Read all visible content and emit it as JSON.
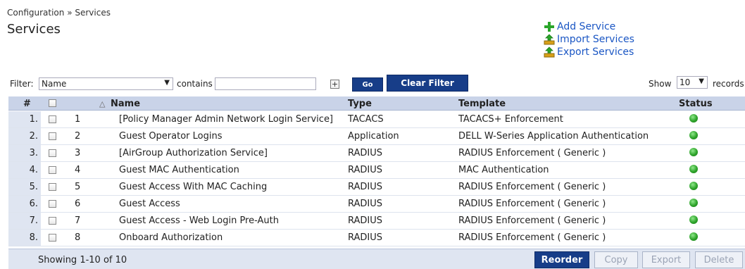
{
  "breadcrumb": "Configuration » Services",
  "page_title": "Services",
  "actions": {
    "add": "Add Service",
    "import": "Import Services",
    "export": "Export Services"
  },
  "filter": {
    "label": "Filter:",
    "field": "Name",
    "operator": "contains",
    "value": "",
    "go": "Go",
    "clear": "Clear Filter",
    "show_label": "Show",
    "show_value": "10",
    "records_label": "records"
  },
  "table": {
    "headers": {
      "num": "#",
      "name": "Name",
      "type": "Type",
      "template": "Template",
      "status": "Status"
    },
    "rows": [
      {
        "num": "1.",
        "order": "1",
        "name": "[Policy Manager Admin Network Login Service]",
        "type": "TACACS",
        "template": "TACACS+ Enforcement",
        "status": "enabled"
      },
      {
        "num": "2.",
        "order": "2",
        "name": "Guest Operator Logins",
        "type": "Application",
        "template": "DELL W-Series Application Authentication",
        "status": "enabled"
      },
      {
        "num": "3.",
        "order": "3",
        "name": "[AirGroup Authorization Service]",
        "type": "RADIUS",
        "template": "RADIUS Enforcement ( Generic )",
        "status": "enabled"
      },
      {
        "num": "4.",
        "order": "4",
        "name": "Guest MAC Authentication",
        "type": "RADIUS",
        "template": "MAC Authentication",
        "status": "enabled"
      },
      {
        "num": "5.",
        "order": "5",
        "name": "Guest Access With MAC Caching",
        "type": "RADIUS",
        "template": "RADIUS Enforcement ( Generic )",
        "status": "enabled"
      },
      {
        "num": "6.",
        "order": "6",
        "name": "Guest Access",
        "type": "RADIUS",
        "template": "RADIUS Enforcement ( Generic )",
        "status": "enabled"
      },
      {
        "num": "7.",
        "order": "7",
        "name": "Guest Access - Web Login Pre-Auth",
        "type": "RADIUS",
        "template": "RADIUS Enforcement ( Generic )",
        "status": "enabled"
      },
      {
        "num": "8.",
        "order": "8",
        "name": "Onboard Authorization",
        "type": "RADIUS",
        "template": "RADIUS Enforcement ( Generic )",
        "status": "enabled"
      }
    ]
  },
  "footer": {
    "showing": "Showing 1-10 of 10",
    "reorder": "Reorder",
    "copy": "Copy",
    "export": "Export",
    "delete": "Delete"
  },
  "colors": {
    "accent": "#173d88",
    "link": "#1a56c4",
    "header_bg": "#c9d3e8",
    "status_on": "#2da32a"
  }
}
